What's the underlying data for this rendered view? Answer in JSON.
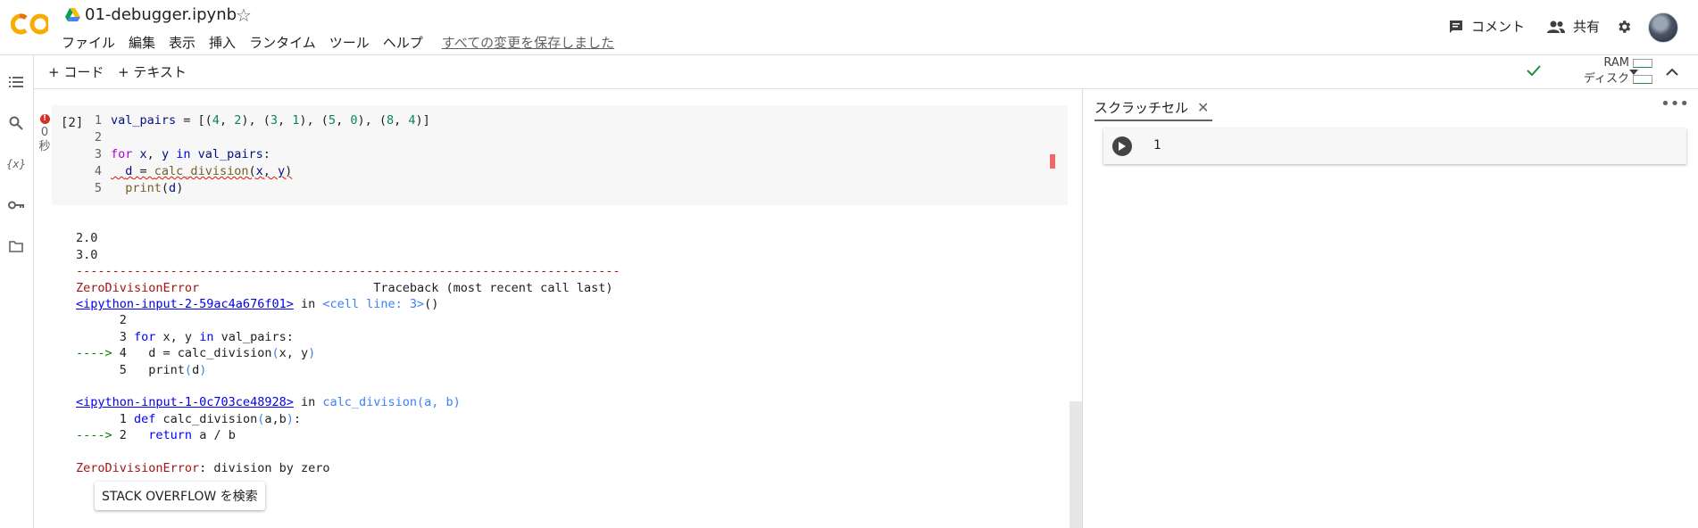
{
  "app": {
    "title": "01-debugger.ipynb"
  },
  "menu": [
    "ファイル",
    "編集",
    "表示",
    "挿入",
    "ランタイム",
    "ツール",
    "ヘルプ"
  ],
  "saved_status": "すべての変更を保存しました",
  "header": {
    "comment_label": "コメント",
    "share_label": "共有"
  },
  "toolbar": {
    "add_code": "+ コード",
    "add_text": "+ テキスト",
    "ram_label": "RAM",
    "disk_label": "ディスク"
  },
  "cell": {
    "exec_count": "[2]",
    "status_time": "0",
    "status_unit": "秒",
    "code_lines": [
      "1",
      "2",
      "3",
      "4",
      "5"
    ]
  },
  "output": {
    "line1": "2.0",
    "line2": "3.0",
    "dashes": "---------------------------------------------------------------------------",
    "err_name": "ZeroDivisionError",
    "traceback_header": "Traceback (most recent call last)",
    "frame1_link": "<ipython-input-2-59ac4a676f01>",
    "frame1_in": " in ",
    "frame1_where": "<cell line: 3>",
    "frame1_paren": "()",
    "frame2_link": "<ipython-input-1-0c703ce48928>",
    "frame2_where": "calc_division",
    "frame2_args": "(a, b)",
    "final_msg": ": division by zero",
    "so_button": "STACK OVERFLOW を検索"
  },
  "scratch": {
    "tab_label": "スクラッチセル",
    "code": "1"
  },
  "colors": {
    "error_red": "#a31515",
    "link_blue": "#0000ee",
    "arrow_green": "#008000",
    "accent_orange": "#f9ab00"
  }
}
